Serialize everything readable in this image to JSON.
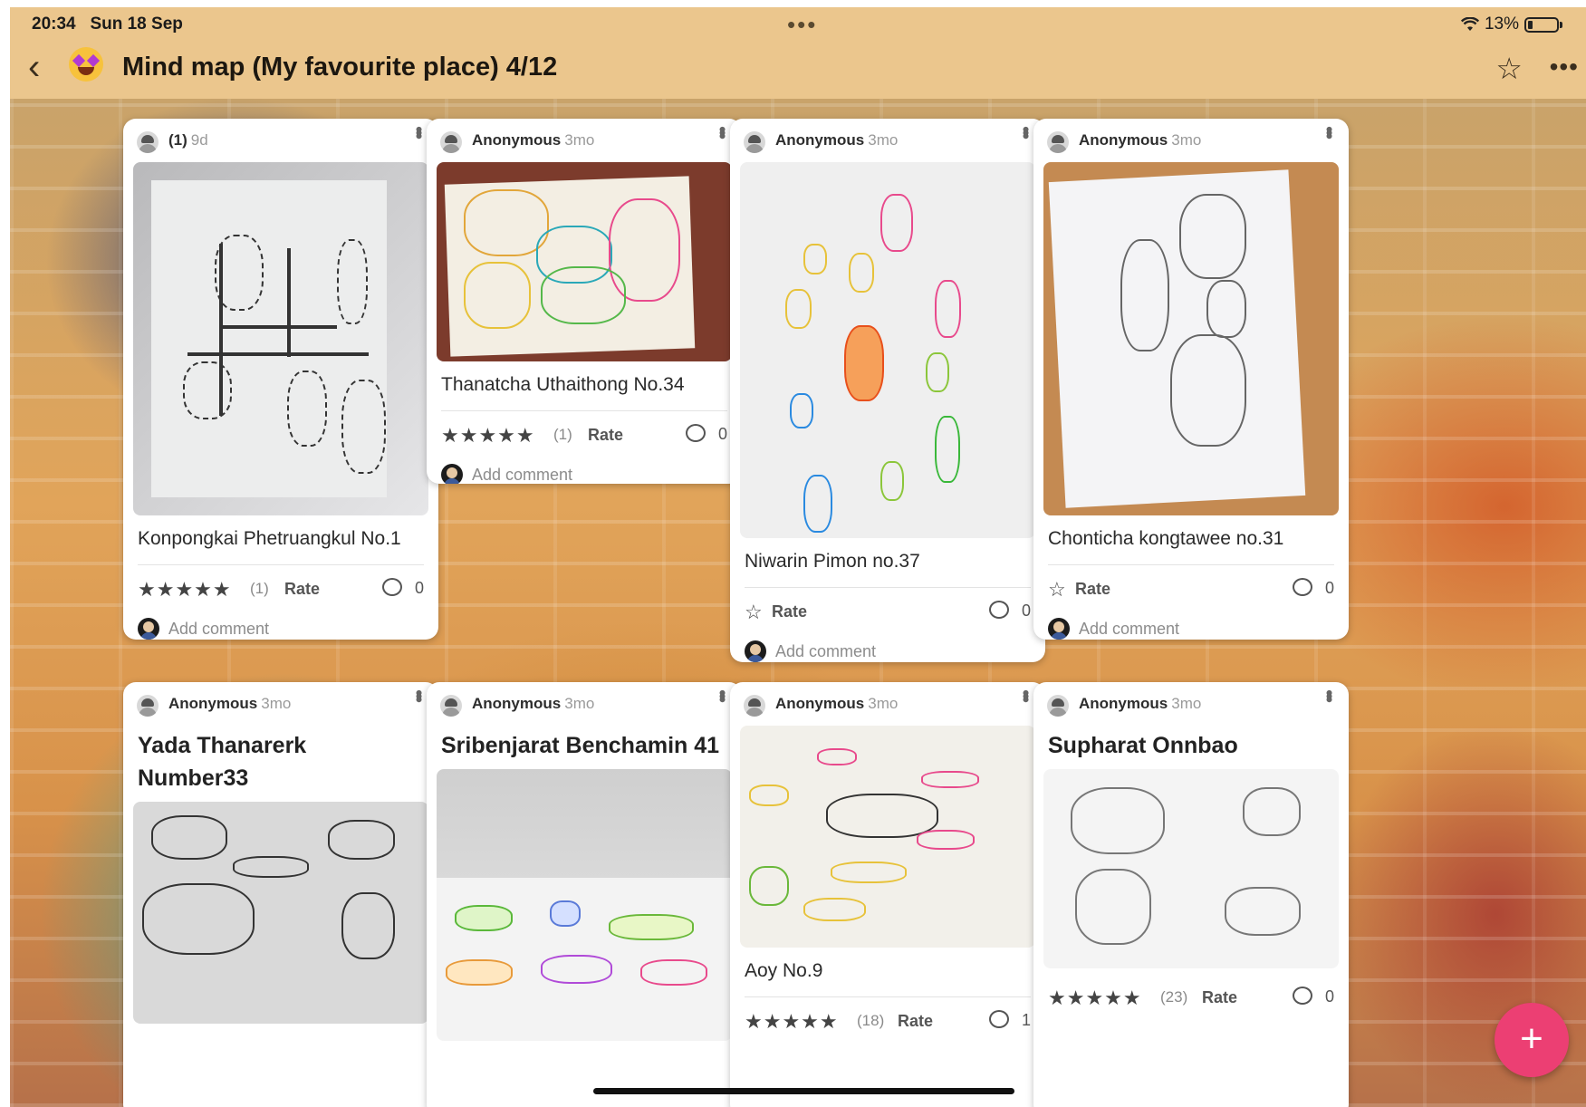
{
  "status_bar": {
    "time": "20:34",
    "date": "Sun 18 Sep",
    "dots": "•••",
    "battery": "13%"
  },
  "header": {
    "title": "Mind map (My favourite place) 4/12"
  },
  "cards": [
    {
      "author": "(1)",
      "age": "9d",
      "caption": "Konpongkai Phetruangkul No.1",
      "rating": "(1)",
      "rate_label": "Rate",
      "comments": "0",
      "add_comment": "Add comment"
    },
    {
      "author": "Anonymous",
      "age": "3mo",
      "caption": "Thanatcha Uthaithong No.34",
      "rating": "(1)",
      "rate_label": "Rate",
      "comments": "0",
      "add_comment": "Add comment"
    },
    {
      "author": "Anonymous",
      "age": "3mo",
      "caption": "Niwarin Pimon no.37",
      "rate_label": "Rate",
      "comments": "0",
      "add_comment": "Add comment"
    },
    {
      "author": "Anonymous",
      "age": "3mo",
      "caption": "Chonticha kongtawee no.31",
      "rate_label": "Rate",
      "comments": "0",
      "add_comment": "Add comment"
    },
    {
      "author": "Anonymous",
      "age": "3mo",
      "title": "Yada Thanarerk Number33"
    },
    {
      "author": "Anonymous",
      "age": "3mo",
      "title": "Sribenjarat Benchamin 41"
    },
    {
      "author": "Anonymous",
      "age": "3mo",
      "caption": "Aoy No.9",
      "rating": "(18)",
      "rate_label": "Rate",
      "comments": "1"
    },
    {
      "author": "Anonymous",
      "age": "3mo",
      "title": "Supharat Onnbao",
      "rating": "(23)",
      "rate_label": "Rate",
      "comments": "0"
    }
  ],
  "fab": {
    "label": "+"
  },
  "colors": {
    "header_bg": "#ebc68d",
    "fab": "#ec3f73"
  }
}
